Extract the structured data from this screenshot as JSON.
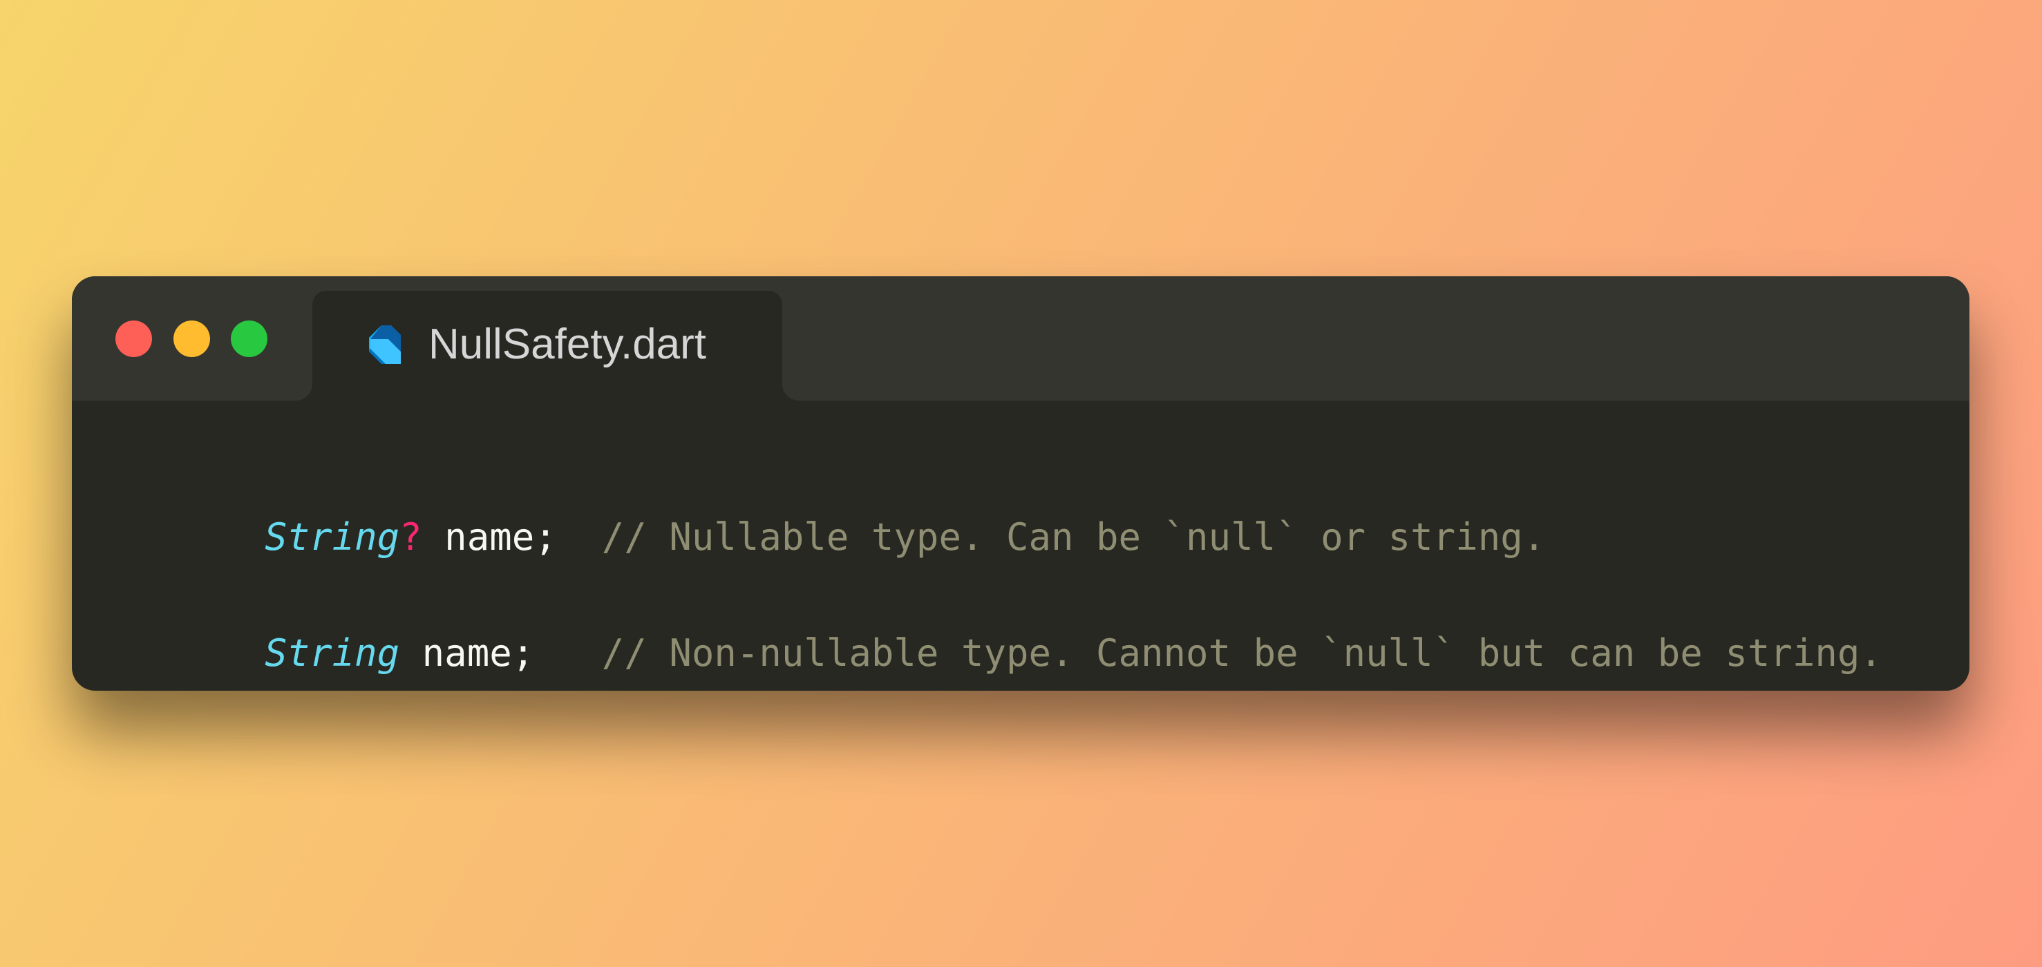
{
  "window": {
    "tab": {
      "title": "NullSafety.dart",
      "icon": "dart-logo-icon"
    },
    "traffic_lights": {
      "close_color": "#fe5f57",
      "minimize_color": "#febc2e",
      "maximize_color": "#28c840"
    }
  },
  "code": {
    "lines": [
      {
        "type": "String",
        "nullable_marker": "?",
        "identifier": " name;",
        "comment": "// Nullable type. Can be `null` or string."
      },
      {
        "type": "String",
        "nullable_marker": "",
        "identifier": " name;",
        "comment": "// Non-nullable type. Cannot be `null` but can be string."
      }
    ]
  },
  "colors": {
    "type": "#66d9ef",
    "nullable": "#f92672",
    "identifier": "#f8f8f2",
    "comment": "#8f8d72",
    "editor_bg": "#272822",
    "titlebar_bg": "#34352f"
  }
}
